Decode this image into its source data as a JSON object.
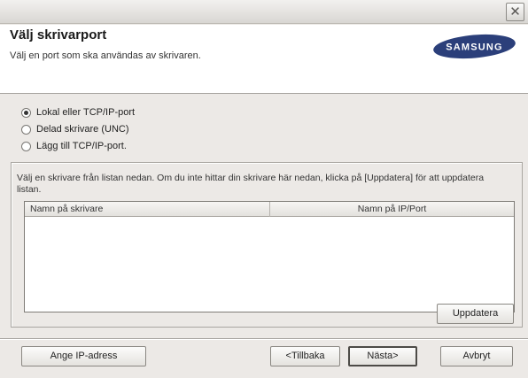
{
  "window": {
    "close_glyph": "✕"
  },
  "header": {
    "title": "Välj skrivarport",
    "subtitle": "Välj en port som ska användas av skrivaren.",
    "logo_text": "SAMSUNG",
    "logo_color": "#2b3f7a"
  },
  "port_options": [
    {
      "label": "Lokal eller TCP/IP-port",
      "checked": true
    },
    {
      "label": "Delad skrivare (UNC)",
      "checked": false
    },
    {
      "label": "Lägg till TCP/IP-port.",
      "checked": false
    }
  ],
  "printer_list": {
    "instruction": "Välj en skrivare från listan nedan. Om du inte hittar din skrivare här nedan, klicka på [Uppdatera] för att uppdatera listan.",
    "columns": [
      "Namn på skrivare",
      "Namn på IP/Port"
    ],
    "rows": [],
    "refresh_label": "Uppdatera"
  },
  "footer": {
    "ip_label": "Ange IP-adress",
    "back_label": "<Tillbaka",
    "next_label": "Nästa>",
    "cancel_label": "Avbryt"
  }
}
